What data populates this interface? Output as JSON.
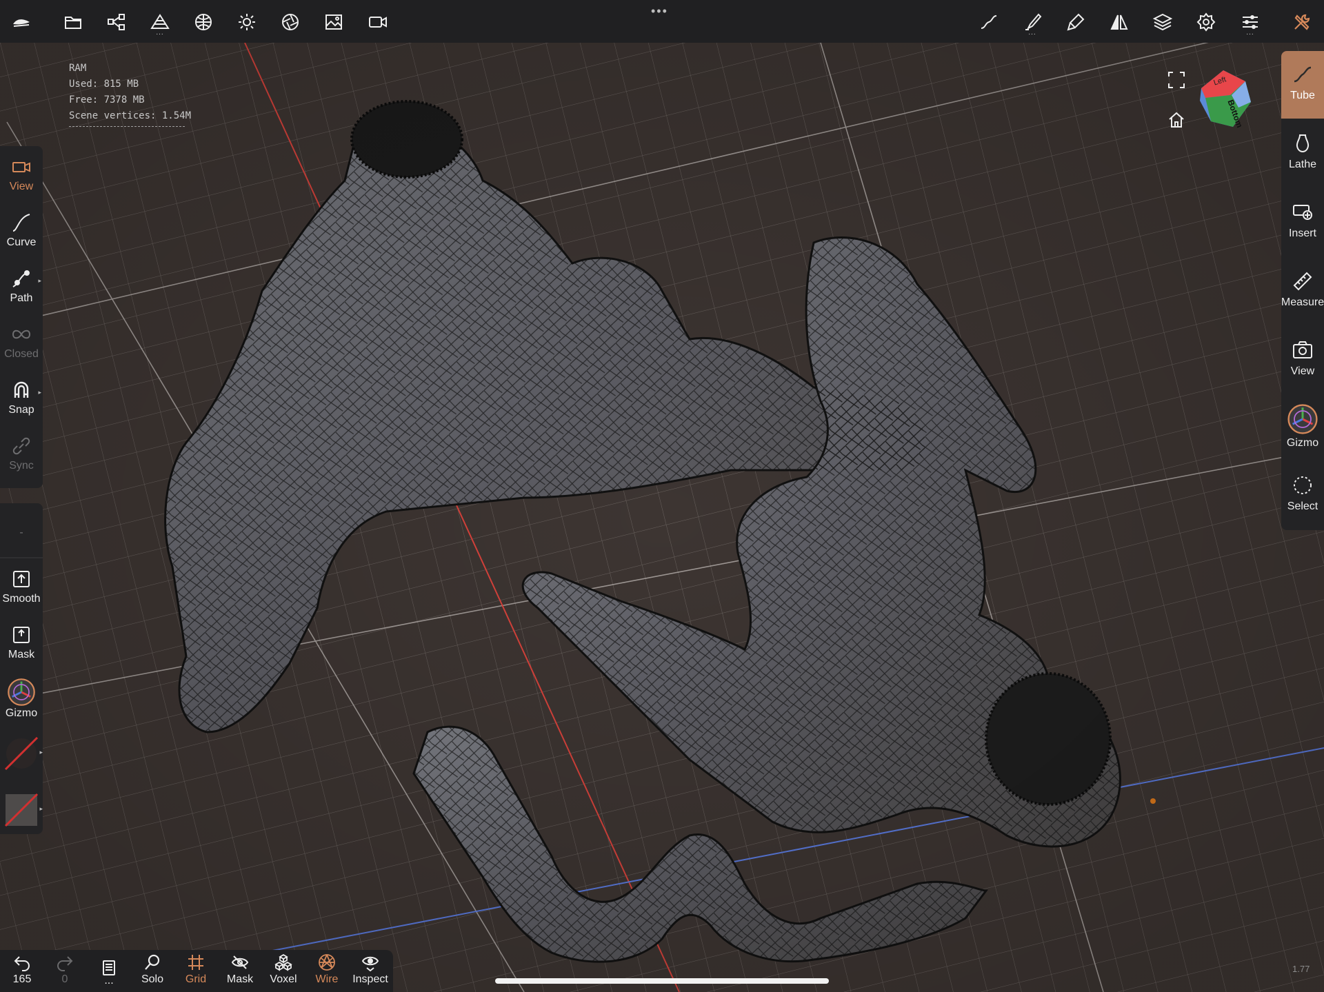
{
  "topbar": {
    "more": "•••",
    "left_icons": [
      "nomad-logo-icon",
      "folder-icon",
      "scene-graph-icon",
      "primitives-icon",
      "material-icon",
      "light-icon",
      "shading-icon",
      "background-image-icon",
      "camera-icon"
    ],
    "right_icons": [
      "stroke-icon",
      "brush-icon",
      "tool-icon",
      "symmetry-icon",
      "layers-icon",
      "settings-icon",
      "preferences-icon",
      "tools-menu-icon"
    ]
  },
  "ram": {
    "title": "RAM",
    "used": "Used: 815 MB",
    "free": "Free: 7378 MB",
    "vertices": "Scene vertices: 1.54M"
  },
  "left_toolbar": {
    "items": [
      {
        "label": "View",
        "icon": "camera-icon",
        "state": "active"
      },
      {
        "label": "Curve",
        "icon": "curve-icon",
        "state": "normal"
      },
      {
        "label": "Path",
        "icon": "path-icon",
        "state": "normal"
      },
      {
        "label": "Closed",
        "icon": "infinity-icon",
        "state": "disabled"
      },
      {
        "label": "Snap",
        "icon": "magnet-icon",
        "state": "normal"
      },
      {
        "label": "Sync",
        "icon": "link-icon",
        "state": "disabled"
      }
    ],
    "lower": [
      {
        "label": "-",
        "icon": "",
        "state": "disabled"
      },
      {
        "label": "Smooth",
        "icon": "smooth-icon",
        "state": "normal"
      },
      {
        "label": "Mask",
        "icon": "mask-icon",
        "state": "normal"
      },
      {
        "label": "Gizmo",
        "icon": "gizmo-icon",
        "state": "normal"
      }
    ]
  },
  "right_toolbar": {
    "items": [
      {
        "label": "Tube",
        "icon": "tube-icon",
        "state": "active"
      },
      {
        "label": "Lathe",
        "icon": "lathe-icon",
        "state": "normal"
      },
      {
        "label": "Insert",
        "icon": "insert-icon",
        "state": "normal"
      },
      {
        "label": "Measure",
        "icon": "ruler-icon",
        "state": "normal"
      },
      {
        "label": "View",
        "icon": "view-camera-icon",
        "state": "normal"
      },
      {
        "label": "Gizmo",
        "icon": "gizmo-icon",
        "state": "normal"
      },
      {
        "label": "Select",
        "icon": "select-icon",
        "state": "normal"
      }
    ]
  },
  "bottom_toolbar": {
    "items": [
      {
        "label": "165",
        "icon": "undo-icon",
        "state": "normal"
      },
      {
        "label": "0",
        "icon": "redo-icon",
        "state": "disabled"
      },
      {
        "label": "...",
        "icon": "notebook-icon",
        "state": "normal"
      },
      {
        "label": "Solo",
        "icon": "solo-search-icon",
        "state": "normal"
      },
      {
        "label": "Grid",
        "icon": "grid-icon",
        "state": "active"
      },
      {
        "label": "Mask",
        "icon": "mask-eye-icon",
        "state": "normal"
      },
      {
        "label": "Voxel",
        "icon": "voxel-icon",
        "state": "normal"
      },
      {
        "label": "Wire",
        "icon": "wireframe-icon",
        "state": "active"
      },
      {
        "label": "Inspect",
        "icon": "inspect-icon",
        "state": "normal"
      }
    ]
  },
  "viewcube": {
    "face_left": "Left",
    "face_bottom": "Bottom"
  },
  "zoom": "1.77",
  "colors": {
    "accent": "#d6895a",
    "axis_x": "#d9433c",
    "axis_z": "#5b7be0",
    "bar": "#202022"
  }
}
